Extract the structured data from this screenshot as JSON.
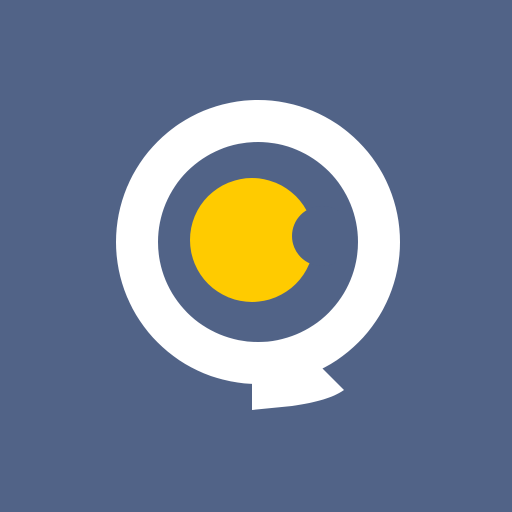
{
  "icon": {
    "name": "chat-bubble-moon-logo",
    "colors": {
      "background": "#516387",
      "bubble": "#ffffff",
      "moon": "#ffcb00"
    }
  }
}
